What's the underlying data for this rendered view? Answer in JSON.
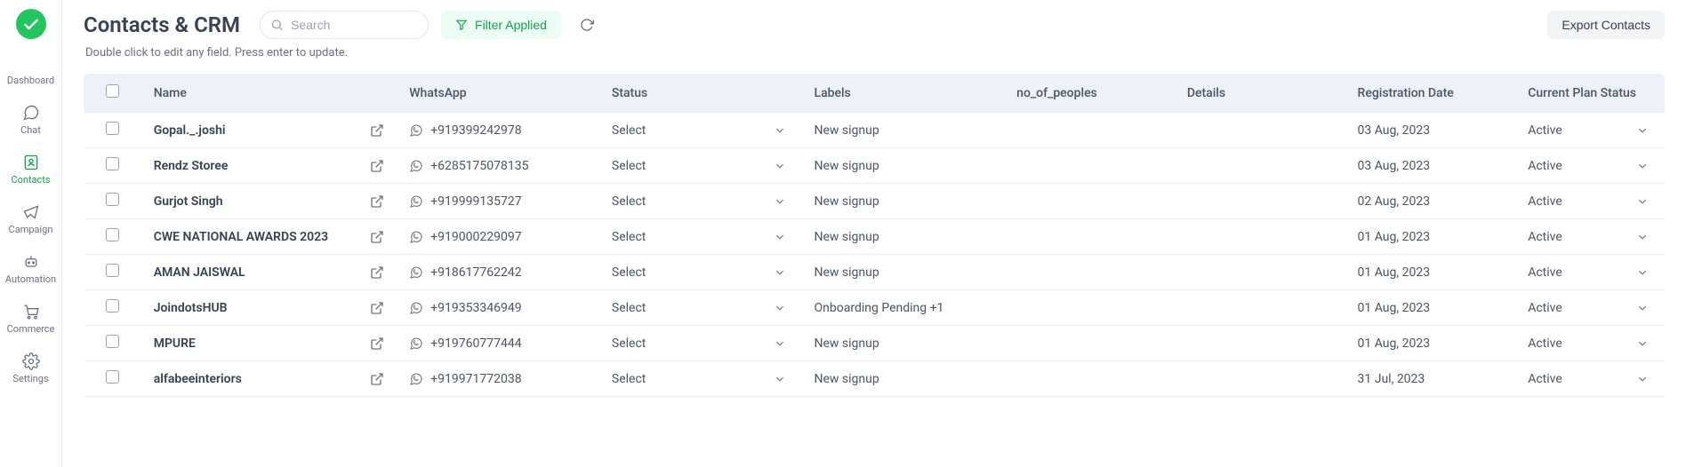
{
  "sidebar": {
    "items": [
      {
        "label": "Dashboard"
      },
      {
        "label": "Chat"
      },
      {
        "label": "Contacts"
      },
      {
        "label": "Campaign"
      },
      {
        "label": "Automation"
      },
      {
        "label": "Commerce"
      },
      {
        "label": "Settings"
      }
    ]
  },
  "header": {
    "title": "Contacts & CRM",
    "search_placeholder": "Search",
    "filter_label": "Filter Applied",
    "export_label": "Export Contacts",
    "subtitle": "Double click to edit any field. Press enter to update."
  },
  "table": {
    "columns": {
      "name": "Name",
      "whatsapp": "WhatsApp",
      "status": "Status",
      "labels": "Labels",
      "no_of_peoples": "no_of_peoples",
      "details": "Details",
      "registration_date": "Registration Date",
      "plan_status": "Current Plan Status"
    },
    "status_placeholder": "Select",
    "rows": [
      {
        "name": "Gopal._.joshi",
        "whatsapp": "+919399242978",
        "labels": "New signup",
        "no_of_peoples": "",
        "details": "",
        "registration_date": "03 Aug, 2023",
        "plan_status": "Active"
      },
      {
        "name": "Rendz Storee",
        "whatsapp": "+6285175078135",
        "labels": "New signup",
        "no_of_peoples": "",
        "details": "",
        "registration_date": "03 Aug, 2023",
        "plan_status": "Active"
      },
      {
        "name": "Gurjot Singh",
        "whatsapp": "+919999135727",
        "labels": "New signup",
        "no_of_peoples": "",
        "details": "",
        "registration_date": "02 Aug, 2023",
        "plan_status": "Active"
      },
      {
        "name": "CWE NATIONAL AWARDS 2023",
        "whatsapp": "+919000229097",
        "labels": "New signup",
        "no_of_peoples": "",
        "details": "",
        "registration_date": "01 Aug, 2023",
        "plan_status": "Active"
      },
      {
        "name": "AMAN JAISWAL",
        "whatsapp": "+918617762242",
        "labels": "New signup",
        "no_of_peoples": "",
        "details": "",
        "registration_date": "01 Aug, 2023",
        "plan_status": "Active"
      },
      {
        "name": "JoindotsHUB",
        "whatsapp": "+919353346949",
        "labels": "Onboarding Pending +1",
        "no_of_peoples": "",
        "details": "",
        "registration_date": "01 Aug, 2023",
        "plan_status": "Active"
      },
      {
        "name": "MPURE",
        "whatsapp": "+919760777444",
        "labels": "New signup",
        "no_of_peoples": "",
        "details": "",
        "registration_date": "01 Aug, 2023",
        "plan_status": "Active"
      },
      {
        "name": "alfabeeinteriors",
        "whatsapp": "+919971772038",
        "labels": "New signup",
        "no_of_peoples": "",
        "details": "",
        "registration_date": "31 Jul, 2023",
        "plan_status": "Active"
      }
    ]
  }
}
